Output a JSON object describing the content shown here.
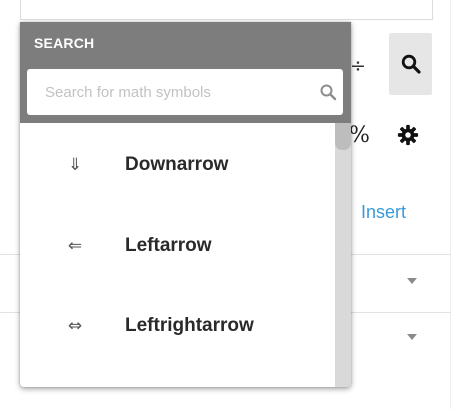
{
  "editor": {
    "divide_symbol": "÷",
    "percent_symbol": "%",
    "insert_label": "Insert",
    "search_button_icon": "search-icon",
    "settings_icon": "gear-icon"
  },
  "search_popup": {
    "title": "SEARCH",
    "search_placeholder": "Search for math symbols",
    "search_value": "",
    "results": [
      {
        "symbol": "⇓",
        "label": "Downarrow"
      },
      {
        "symbol": "⇐",
        "label": "Leftarrow"
      },
      {
        "symbol": "⇔",
        "label": "Leftrightarrow"
      }
    ]
  },
  "colors": {
    "header_bg": "#7d7d7d",
    "insert_link": "#3a9ad9",
    "scrollbar_track": "#d9d9d9",
    "scrollbar_thumb": "#bdbdbd"
  }
}
